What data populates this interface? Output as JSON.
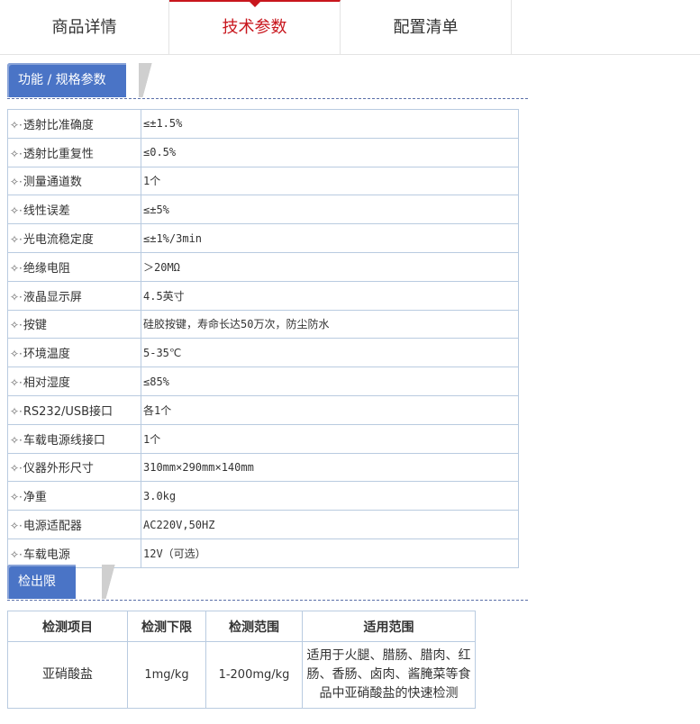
{
  "tabs": [
    {
      "label": "商品详情"
    },
    {
      "label": "技术参数"
    },
    {
      "label": "配置清单"
    }
  ],
  "sections": {
    "spec_title": "功能 / 规格参数",
    "detect_title": "检出限"
  },
  "bullet": "✧·",
  "specs": [
    {
      "key": "透射比准确度",
      "value": "≤±1.5%"
    },
    {
      "key": "透射比重复性",
      "value": "≤0.5%"
    },
    {
      "key": "测量通道数",
      "value": "1个"
    },
    {
      "key": "线性误差",
      "value": "≤±5%"
    },
    {
      "key": "光电流稳定度",
      "value": "≤±1%/3min"
    },
    {
      "key": "绝缘电阻",
      "value": "＞20MΩ"
    },
    {
      "key": "液晶显示屏",
      "value": "4.5英寸"
    },
    {
      "key": "按键",
      "value": "硅胶按键，寿命长达50万次，防尘防水"
    },
    {
      "key": "环境温度",
      "value": "5-35℃"
    },
    {
      "key": "相对湿度",
      "value": "≤85%"
    },
    {
      "key": "RS232/USB接口",
      "value": "各1个"
    },
    {
      "key": "车载电源线接口",
      "value": "1个"
    },
    {
      "key": "仪器外形尺寸",
      "value": "310mm×290mm×140mm"
    },
    {
      "key": "净重",
      "value": "3.0kg"
    },
    {
      "key": "电源适配器",
      "value": "AC220V,50HZ"
    },
    {
      "key": "车载电源",
      "value": "12V（可选）"
    }
  ],
  "detection": {
    "headers": [
      "检测项目",
      "检测下限",
      "检测范围",
      "适用范围"
    ],
    "rows": [
      {
        "item": "亚硝酸盐",
        "lower": "1mg/kg",
        "range": "1-200mg/kg",
        "scope": "适用于火腿、腊肠、腊肉、红肠、香肠、卤肉、酱腌菜等食品中亚硝酸盐的快速检测"
      }
    ]
  }
}
